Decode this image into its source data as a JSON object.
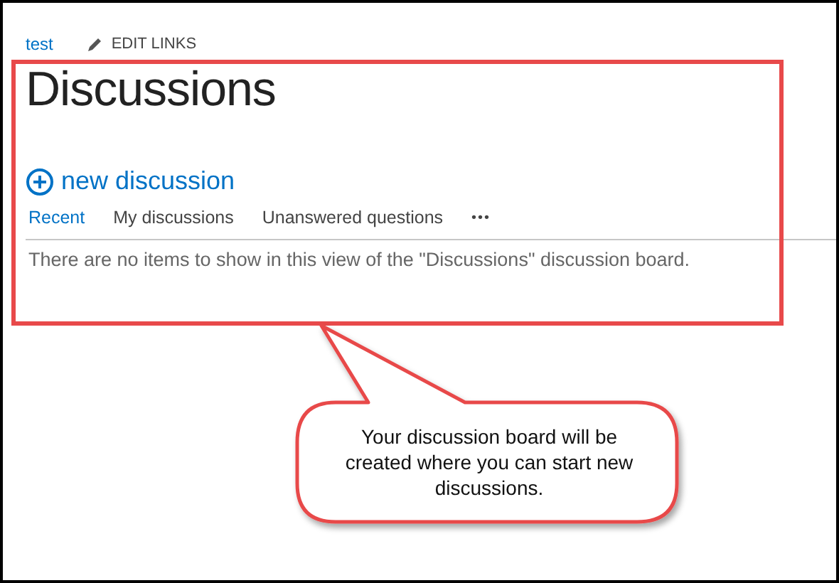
{
  "top_links": {
    "site_link": "test",
    "edit_links": "EDIT LINKS"
  },
  "page_title": "Discussions",
  "new_item": {
    "label": "new discussion"
  },
  "views": [
    {
      "label": "Recent",
      "selected": true
    },
    {
      "label": "My discussions",
      "selected": false
    },
    {
      "label": "Unanswered questions",
      "selected": false
    }
  ],
  "more_button": "•••",
  "empty_message": "There are no items to show in this view of the \"Discussions\" discussion board.",
  "callout": {
    "text": "Your discussion board will be created where you can start new discussions."
  }
}
